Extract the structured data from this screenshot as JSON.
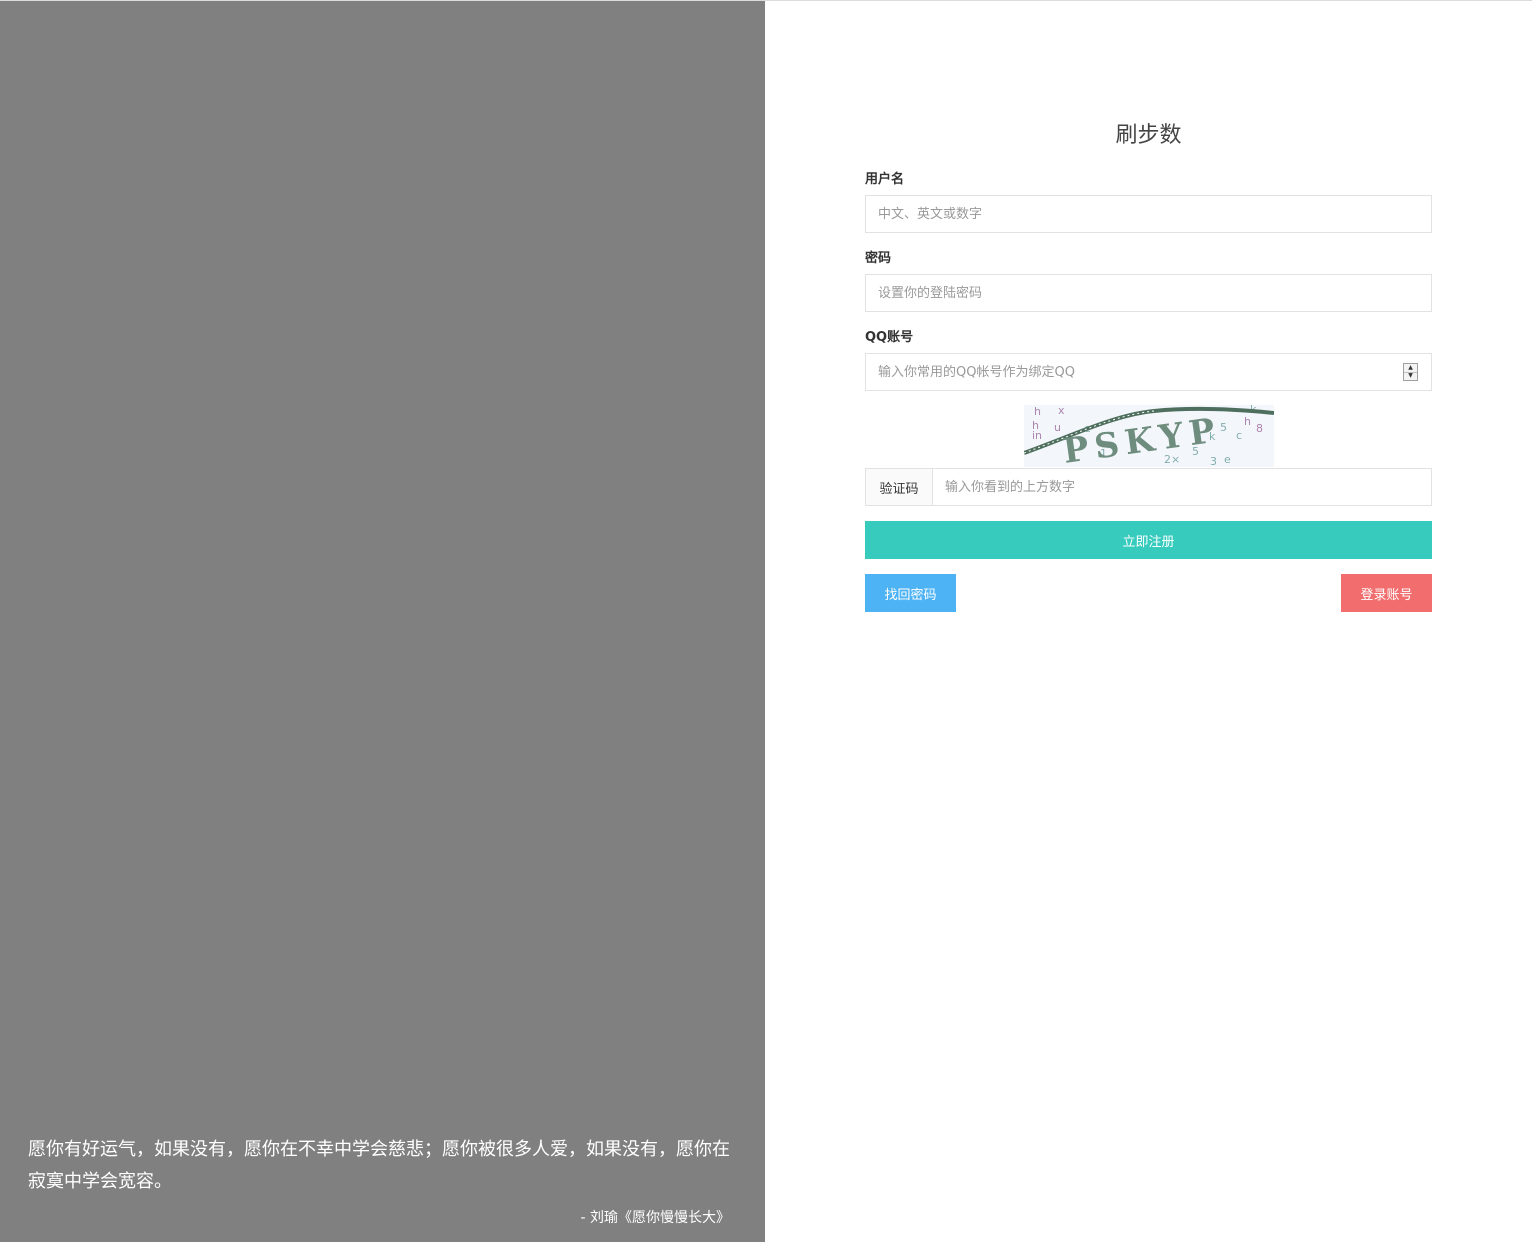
{
  "quote": {
    "text": "愿你有好运气，如果没有，愿你在不幸中学会慈悲；愿你被很多人爱，如果没有，愿你在寂寞中学会宽容。",
    "author": "- 刘瑜《愿你慢慢长大》"
  },
  "form": {
    "title": "刷步数",
    "username": {
      "label": "用户名",
      "placeholder": "中文、英文或数字",
      "value": ""
    },
    "password": {
      "label": "密码",
      "placeholder": "设置你的登陆密码",
      "value": ""
    },
    "qq": {
      "label": "QQ账号",
      "placeholder": "输入你常用的QQ帐号作为绑定QQ",
      "value": ""
    },
    "captcha": {
      "image_text": "PSKYP",
      "addon_label": "验证码",
      "placeholder": "输入你看到的上方数字",
      "value": ""
    },
    "register_label": "立即注册",
    "forgot_label": "找回密码",
    "login_label": "登录账号"
  },
  "colors": {
    "left_panel": "#808080",
    "register_button": "#36cbbd",
    "forgot_button": "#4db3f4",
    "login_button": "#f26e6e"
  }
}
